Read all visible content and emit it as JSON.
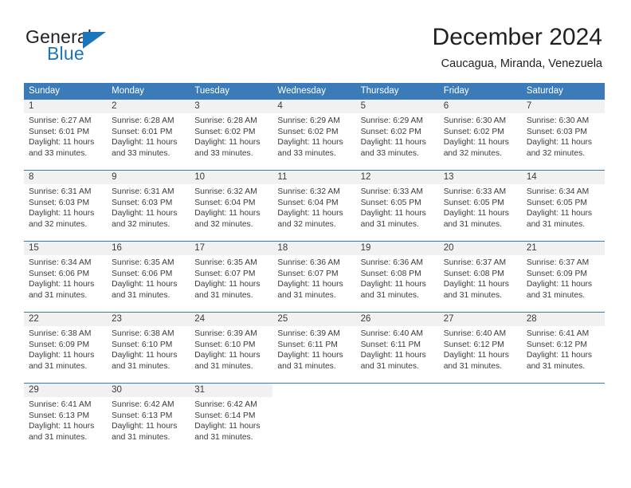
{
  "brand": {
    "word_one": "General",
    "word_two": "Blue",
    "mark": "triangle-logo"
  },
  "header": {
    "month_title": "December 2024",
    "location": "Caucagua, Miranda, Venezuela"
  },
  "theme": {
    "header_blue": "#3b7cb8",
    "brand_blue": "#1b75bb",
    "daynum_band": "#f1f1f1",
    "text": "#3b3b3b"
  },
  "weekdays": [
    "Sunday",
    "Monday",
    "Tuesday",
    "Wednesday",
    "Thursday",
    "Friday",
    "Saturday"
  ],
  "weeks": [
    [
      {
        "day": "1",
        "sunrise": "Sunrise: 6:27 AM",
        "sunset": "Sunset: 6:01 PM",
        "daylight1": "Daylight: 11 hours",
        "daylight2": "and 33 minutes."
      },
      {
        "day": "2",
        "sunrise": "Sunrise: 6:28 AM",
        "sunset": "Sunset: 6:01 PM",
        "daylight1": "Daylight: 11 hours",
        "daylight2": "and 33 minutes."
      },
      {
        "day": "3",
        "sunrise": "Sunrise: 6:28 AM",
        "sunset": "Sunset: 6:02 PM",
        "daylight1": "Daylight: 11 hours",
        "daylight2": "and 33 minutes."
      },
      {
        "day": "4",
        "sunrise": "Sunrise: 6:29 AM",
        "sunset": "Sunset: 6:02 PM",
        "daylight1": "Daylight: 11 hours",
        "daylight2": "and 33 minutes."
      },
      {
        "day": "5",
        "sunrise": "Sunrise: 6:29 AM",
        "sunset": "Sunset: 6:02 PM",
        "daylight1": "Daylight: 11 hours",
        "daylight2": "and 33 minutes."
      },
      {
        "day": "6",
        "sunrise": "Sunrise: 6:30 AM",
        "sunset": "Sunset: 6:02 PM",
        "daylight1": "Daylight: 11 hours",
        "daylight2": "and 32 minutes."
      },
      {
        "day": "7",
        "sunrise": "Sunrise: 6:30 AM",
        "sunset": "Sunset: 6:03 PM",
        "daylight1": "Daylight: 11 hours",
        "daylight2": "and 32 minutes."
      }
    ],
    [
      {
        "day": "8",
        "sunrise": "Sunrise: 6:31 AM",
        "sunset": "Sunset: 6:03 PM",
        "daylight1": "Daylight: 11 hours",
        "daylight2": "and 32 minutes."
      },
      {
        "day": "9",
        "sunrise": "Sunrise: 6:31 AM",
        "sunset": "Sunset: 6:03 PM",
        "daylight1": "Daylight: 11 hours",
        "daylight2": "and 32 minutes."
      },
      {
        "day": "10",
        "sunrise": "Sunrise: 6:32 AM",
        "sunset": "Sunset: 6:04 PM",
        "daylight1": "Daylight: 11 hours",
        "daylight2": "and 32 minutes."
      },
      {
        "day": "11",
        "sunrise": "Sunrise: 6:32 AM",
        "sunset": "Sunset: 6:04 PM",
        "daylight1": "Daylight: 11 hours",
        "daylight2": "and 32 minutes."
      },
      {
        "day": "12",
        "sunrise": "Sunrise: 6:33 AM",
        "sunset": "Sunset: 6:05 PM",
        "daylight1": "Daylight: 11 hours",
        "daylight2": "and 31 minutes."
      },
      {
        "day": "13",
        "sunrise": "Sunrise: 6:33 AM",
        "sunset": "Sunset: 6:05 PM",
        "daylight1": "Daylight: 11 hours",
        "daylight2": "and 31 minutes."
      },
      {
        "day": "14",
        "sunrise": "Sunrise: 6:34 AM",
        "sunset": "Sunset: 6:05 PM",
        "daylight1": "Daylight: 11 hours",
        "daylight2": "and 31 minutes."
      }
    ],
    [
      {
        "day": "15",
        "sunrise": "Sunrise: 6:34 AM",
        "sunset": "Sunset: 6:06 PM",
        "daylight1": "Daylight: 11 hours",
        "daylight2": "and 31 minutes."
      },
      {
        "day": "16",
        "sunrise": "Sunrise: 6:35 AM",
        "sunset": "Sunset: 6:06 PM",
        "daylight1": "Daylight: 11 hours",
        "daylight2": "and 31 minutes."
      },
      {
        "day": "17",
        "sunrise": "Sunrise: 6:35 AM",
        "sunset": "Sunset: 6:07 PM",
        "daylight1": "Daylight: 11 hours",
        "daylight2": "and 31 minutes."
      },
      {
        "day": "18",
        "sunrise": "Sunrise: 6:36 AM",
        "sunset": "Sunset: 6:07 PM",
        "daylight1": "Daylight: 11 hours",
        "daylight2": "and 31 minutes."
      },
      {
        "day": "19",
        "sunrise": "Sunrise: 6:36 AM",
        "sunset": "Sunset: 6:08 PM",
        "daylight1": "Daylight: 11 hours",
        "daylight2": "and 31 minutes."
      },
      {
        "day": "20",
        "sunrise": "Sunrise: 6:37 AM",
        "sunset": "Sunset: 6:08 PM",
        "daylight1": "Daylight: 11 hours",
        "daylight2": "and 31 minutes."
      },
      {
        "day": "21",
        "sunrise": "Sunrise: 6:37 AM",
        "sunset": "Sunset: 6:09 PM",
        "daylight1": "Daylight: 11 hours",
        "daylight2": "and 31 minutes."
      }
    ],
    [
      {
        "day": "22",
        "sunrise": "Sunrise: 6:38 AM",
        "sunset": "Sunset: 6:09 PM",
        "daylight1": "Daylight: 11 hours",
        "daylight2": "and 31 minutes."
      },
      {
        "day": "23",
        "sunrise": "Sunrise: 6:38 AM",
        "sunset": "Sunset: 6:10 PM",
        "daylight1": "Daylight: 11 hours",
        "daylight2": "and 31 minutes."
      },
      {
        "day": "24",
        "sunrise": "Sunrise: 6:39 AM",
        "sunset": "Sunset: 6:10 PM",
        "daylight1": "Daylight: 11 hours",
        "daylight2": "and 31 minutes."
      },
      {
        "day": "25",
        "sunrise": "Sunrise: 6:39 AM",
        "sunset": "Sunset: 6:11 PM",
        "daylight1": "Daylight: 11 hours",
        "daylight2": "and 31 minutes."
      },
      {
        "day": "26",
        "sunrise": "Sunrise: 6:40 AM",
        "sunset": "Sunset: 6:11 PM",
        "daylight1": "Daylight: 11 hours",
        "daylight2": "and 31 minutes."
      },
      {
        "day": "27",
        "sunrise": "Sunrise: 6:40 AM",
        "sunset": "Sunset: 6:12 PM",
        "daylight1": "Daylight: 11 hours",
        "daylight2": "and 31 minutes."
      },
      {
        "day": "28",
        "sunrise": "Sunrise: 6:41 AM",
        "sunset": "Sunset: 6:12 PM",
        "daylight1": "Daylight: 11 hours",
        "daylight2": "and 31 minutes."
      }
    ],
    [
      {
        "day": "29",
        "sunrise": "Sunrise: 6:41 AM",
        "sunset": "Sunset: 6:13 PM",
        "daylight1": "Daylight: 11 hours",
        "daylight2": "and 31 minutes."
      },
      {
        "day": "30",
        "sunrise": "Sunrise: 6:42 AM",
        "sunset": "Sunset: 6:13 PM",
        "daylight1": "Daylight: 11 hours",
        "daylight2": "and 31 minutes."
      },
      {
        "day": "31",
        "sunrise": "Sunrise: 6:42 AM",
        "sunset": "Sunset: 6:14 PM",
        "daylight1": "Daylight: 11 hours",
        "daylight2": "and 31 minutes."
      },
      {
        "day": "",
        "sunrise": "",
        "sunset": "",
        "daylight1": "",
        "daylight2": ""
      },
      {
        "day": "",
        "sunrise": "",
        "sunset": "",
        "daylight1": "",
        "daylight2": ""
      },
      {
        "day": "",
        "sunrise": "",
        "sunset": "",
        "daylight1": "",
        "daylight2": ""
      },
      {
        "day": "",
        "sunrise": "",
        "sunset": "",
        "daylight1": "",
        "daylight2": ""
      }
    ]
  ]
}
